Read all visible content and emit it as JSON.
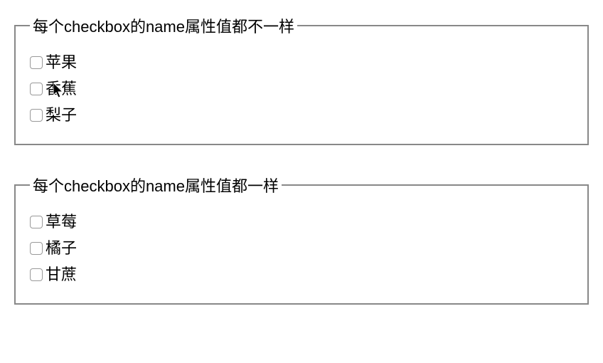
{
  "group1": {
    "legend": "每个checkbox的name属性值都不一样",
    "options": [
      {
        "label": "苹果"
      },
      {
        "label": "香蕉"
      },
      {
        "label": "梨子"
      }
    ]
  },
  "group2": {
    "legend": "每个checkbox的name属性值都一样",
    "options": [
      {
        "label": "草莓"
      },
      {
        "label": "橘子"
      },
      {
        "label": "甘蔗"
      }
    ]
  }
}
